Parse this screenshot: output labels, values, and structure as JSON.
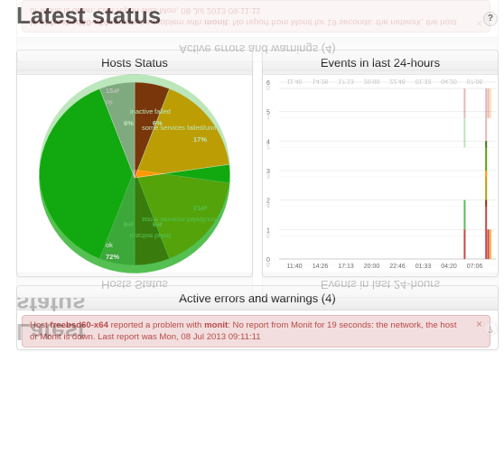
{
  "page": {
    "title": "Latest status",
    "help_label": "?"
  },
  "hosts_panel": {
    "title": "Hosts Status"
  },
  "events_panel": {
    "title": "Events in last 24-hours"
  },
  "errors_panel": {
    "title": "Active errors and warnings (4)"
  },
  "alert": {
    "prefix": "Host",
    "host": "freebsd60-x64",
    "middle": "reported a problem with",
    "service": "monit",
    "message": ": No report from Monit for 19 seconds: the network, the host or Monit is down. Last report was Mon, 08 Jul 2013 09:11:11",
    "close_label": "×"
  },
  "colors": {
    "ok": "#1aa319",
    "failed": "#ff9900",
    "inactive": "#aaaaaa",
    "red": "#aa0000"
  },
  "chart_data": [
    {
      "type": "pie",
      "title": "Hosts Status",
      "slices": [
        {
          "label": "ok",
          "value": 72,
          "display": "72%",
          "color": "#12a80f"
        },
        {
          "label": "some services failed/unmonitored",
          "display_label": "some services failed/unm",
          "value": 17,
          "display": "17%",
          "color": "#ff9900"
        },
        {
          "label": "failed",
          "value": 6,
          "display": "6%",
          "color": "#a30a0a"
        },
        {
          "label": "inactive",
          "value": 6,
          "display": "6%",
          "color": "#aaaaaa"
        }
      ]
    },
    {
      "type": "bar",
      "title": "Events in last 24-hours",
      "ylim": [
        0,
        6
      ],
      "yticks": [
        0,
        1,
        2,
        3,
        4,
        5,
        6
      ],
      "xticks": [
        "11:40",
        "14:26",
        "17:13",
        "20:00",
        "22:46",
        "01:33",
        "04:20",
        "07:06"
      ],
      "series": [
        {
          "color": "#b30000",
          "points": [
            {
              "x": 0.856,
              "value": 1
            },
            {
              "x": 0.955,
              "value": 2
            },
            {
              "x": 0.965,
              "value": 1
            }
          ]
        },
        {
          "color": "#ff9900",
          "points": [
            {
              "x": 0.955,
              "value": 1
            },
            {
              "x": 0.975,
              "value": 1
            }
          ]
        },
        {
          "color": "#1aa319",
          "points": [
            {
              "x": 0.856,
              "value": 1
            },
            {
              "x": 0.955,
              "value": 1
            }
          ]
        }
      ]
    }
  ]
}
